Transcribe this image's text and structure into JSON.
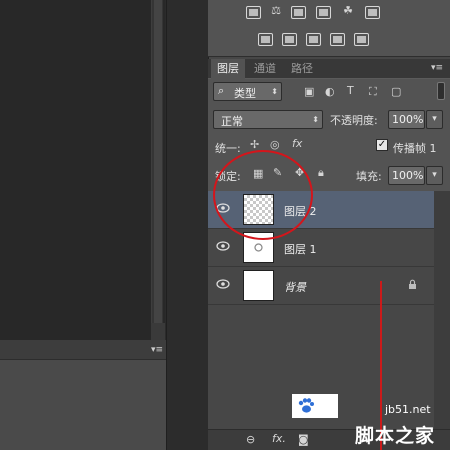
{
  "layers_panel": {
    "tabs": [
      {
        "label": "图层",
        "active": true
      },
      {
        "label": "通道",
        "active": false
      },
      {
        "label": "路径",
        "active": false
      }
    ],
    "filter": {
      "type_icon": "search-icon",
      "value": "类型"
    },
    "blend_mode": "正常",
    "opacity_label": "不透明度:",
    "opacity_value": "100%",
    "unify_label": "统一:",
    "propagate_label": "传播帧 1",
    "propagate_checked": true,
    "lock_label": "锁定:",
    "fill_label": "填充:",
    "fill_value": "100%",
    "layers": [
      {
        "name": "图层 2",
        "visible": true,
        "selected": true,
        "thumbnail": "transparent-checker",
        "italic": false
      },
      {
        "name": "图层 1",
        "visible": true,
        "selected": false,
        "thumbnail": "white-with-small-circle",
        "italic": false
      },
      {
        "name": "背景",
        "visible": true,
        "selected": false,
        "thumbnail": "white",
        "italic": true,
        "locked": true
      }
    ],
    "footer_icons": [
      "link-icon",
      "fx-icon",
      "mask-icon"
    ],
    "footer_fx": "fx."
  },
  "watermark": {
    "brand": "脚本之家",
    "domain": "jb51.net"
  },
  "colors": {
    "selected_row": "#566275",
    "annotation_red": "#d4151b",
    "panel_bg": "#535353"
  }
}
